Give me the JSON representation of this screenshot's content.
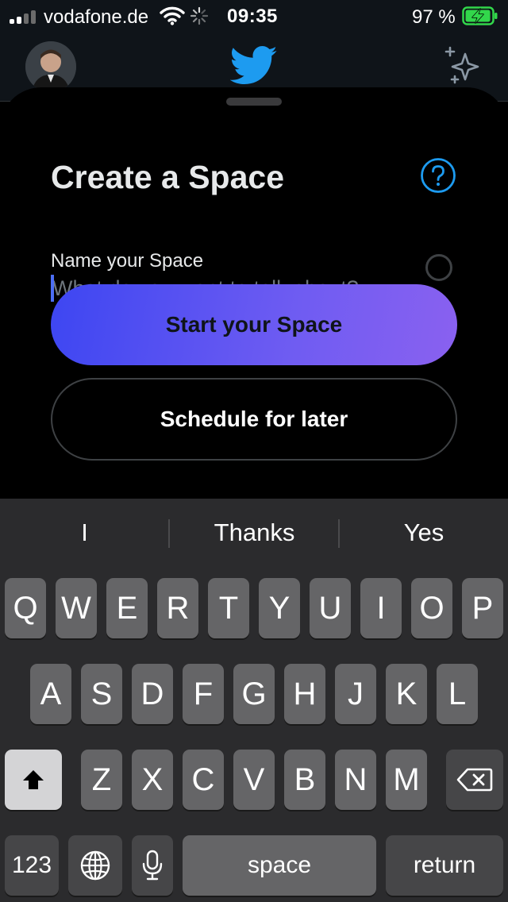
{
  "status_bar": {
    "carrier": "vodafone.de",
    "time": "09:35",
    "battery_percent": "97 %",
    "battery_level": 0.97,
    "signal_bars": 2,
    "icons": [
      "wifi-icon",
      "spinner-icon",
      "charging-battery-icon"
    ]
  },
  "header": {
    "icons": [
      "profile-avatar",
      "twitter-bird-icon",
      "sparkle-icon"
    ]
  },
  "sheet": {
    "title": "Create a Space",
    "help_icon": "question-circle-icon",
    "name_label": "Name your Space",
    "name_placeholder": "What do you want to talk about?",
    "start_button": "Start your Space",
    "schedule_button": "Schedule for later"
  },
  "keyboard": {
    "suggestions": [
      "I",
      "Thanks",
      "Yes"
    ],
    "row1": [
      "Q",
      "W",
      "E",
      "R",
      "T",
      "Y",
      "U",
      "I",
      "O",
      "P"
    ],
    "row2": [
      "A",
      "S",
      "D",
      "F",
      "G",
      "H",
      "J",
      "K",
      "L"
    ],
    "row3": [
      "Z",
      "X",
      "C",
      "V",
      "B",
      "N",
      "M"
    ],
    "numbers_key": "123",
    "space_key": "space",
    "return_key": "return",
    "icons": [
      "shift-icon",
      "backspace-icon",
      "globe-icon",
      "microphone-icon"
    ]
  },
  "colors": {
    "accent_blue": "#1d9bf0",
    "start_gradient_start": "#3d46f2",
    "start_gradient_end": "#8a61f0",
    "battery_green": "#32d74b",
    "keyboard_bg": "#2b2b2d"
  }
}
